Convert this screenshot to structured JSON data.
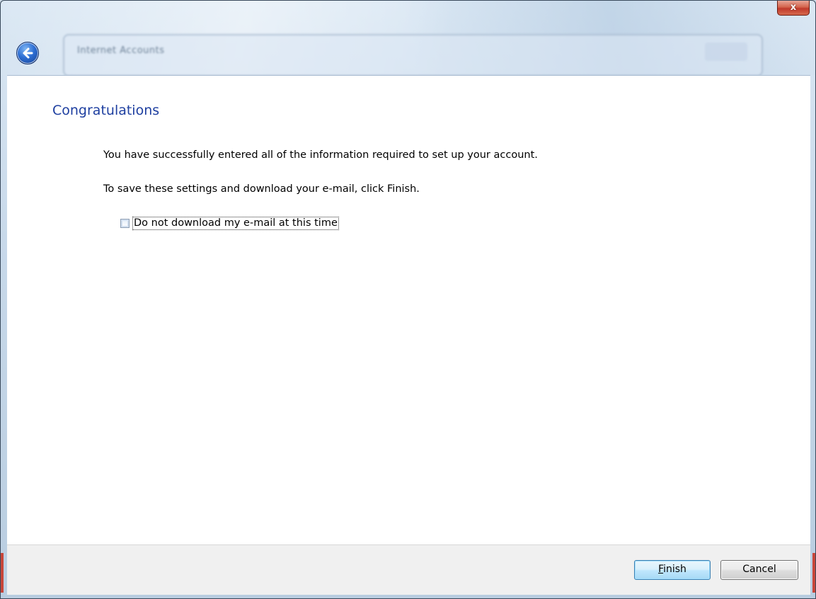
{
  "window": {
    "blurred_title": "Internet Accounts",
    "close_label": "x"
  },
  "main": {
    "title": "Congratulations",
    "line1": "You have successfully entered all of the information required to set up your account.",
    "line2": "To save these settings and download your e-mail, click Finish.",
    "checkbox": {
      "label": "Do not download my e-mail at this time",
      "checked": false
    }
  },
  "footer": {
    "finish_label_accel": "F",
    "finish_label_rest": "inish",
    "cancel_label": "Cancel"
  },
  "colors": {
    "title": "#1e3fa0",
    "content_bg": "#ffffff",
    "footer_bg": "#f0f0f0",
    "close_red": "#c0392b"
  },
  "icons": {
    "back": "back-arrow-icon",
    "close": "close-icon"
  }
}
